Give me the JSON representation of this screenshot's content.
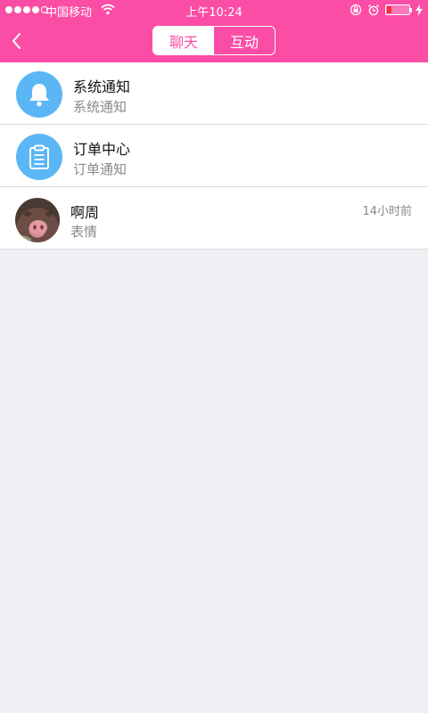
{
  "status_bar": {
    "carrier": "中国移动",
    "time": "上午10:24",
    "battery_level": 0.18
  },
  "header": {
    "tabs": [
      {
        "label": "聊天",
        "active": true
      },
      {
        "label": "互动",
        "active": false
      }
    ]
  },
  "messages": [
    {
      "title": "系统通知",
      "subtitle": "系统通知",
      "icon": "bell-icon",
      "time": ""
    },
    {
      "title": "订单中心",
      "subtitle": "订单通知",
      "icon": "clipboard-icon",
      "time": ""
    },
    {
      "title": "啊周",
      "subtitle": "表情",
      "icon": "avatar-photo",
      "time": "14小时前"
    }
  ],
  "colors": {
    "accent": "#fb4da5",
    "icon_blue": "#5ab6f5",
    "background": "#efeff4"
  }
}
